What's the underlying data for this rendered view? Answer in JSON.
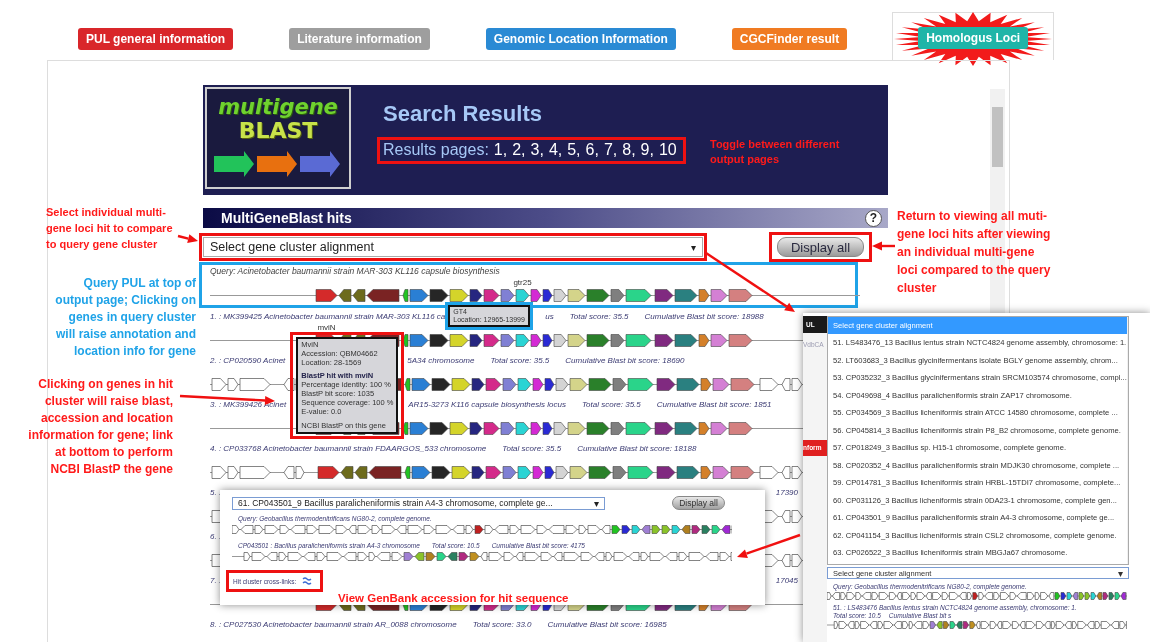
{
  "tabs": [
    {
      "label": "PUL general information",
      "color": "#d9262a",
      "selected": false
    },
    {
      "label": "Literature information",
      "color": "#9e9e9e",
      "selected": false
    },
    {
      "label": "Genomic Location Information",
      "color": "#2a8ad4",
      "selected": false
    },
    {
      "label": "CGCFinder result",
      "color": "#f07b22",
      "selected": false
    },
    {
      "label": "Homologus Loci",
      "color": "#1fb5a8",
      "selected": true
    }
  ],
  "results": {
    "logo": [
      "multigene",
      "BLAST"
    ],
    "title": "Search Results",
    "pages_label": "Results pages:",
    "pages": [
      "1,",
      "2,",
      "3,",
      "4,",
      "5,",
      "6,",
      "7,",
      "8,",
      "9,",
      "10"
    ],
    "hits_header": "MultiGeneBlast hits",
    "help": "?",
    "cluster_select": {
      "value": "Select gene cluster alignment",
      "caret": "▾"
    },
    "display_all": "Display all",
    "query": {
      "title": "Query: Acinetobacter baumannii strain MAR-303 KL116 capsule biosynthesis",
      "gene_label": "gtr25",
      "kind": "aligned"
    },
    "hits": [
      {
        "parts": [
          "1. : MK399425 Acinetobacter baumannii strain MAR-303 KL116 ca",
          "us"
        ],
        "total": "Total score: 35.5",
        "cumulative": "Cumulative Blast bit score: 18988",
        "gene_label": "mviN",
        "kind": "aligned"
      },
      {
        "parts": [
          "2. : CP020590 Acinet",
          "5A34 chromosome"
        ],
        "total": "Total score: 35.5",
        "cumulative": "Cumulative Blast bit score: 18690",
        "kind": "flanked"
      },
      {
        "parts": [
          "3. : MK399426 Acinet",
          "AR15-3273 K116 capsule biosynthesis locus"
        ],
        "total": "Total score: 35.5",
        "cumulative": "Cumulative Blast bit score: 1851",
        "kind": "aligned"
      },
      {
        "parts": [
          "4. : CP033768 Acinetobacter baumannii strain FDAARGOS_533 chromosome"
        ],
        "total": "Total score: 35.5",
        "cumulative": "Cumulative Blast bit score: 18188",
        "kind": "flanked"
      },
      {
        "parts": [
          "5. :"
        ],
        "tail": "17390",
        "kind": "flanked"
      },
      {
        "parts": [
          "6. :"
        ],
        "kind": "flanked"
      },
      {
        "parts": [
          "7. :"
        ],
        "tail": "17045",
        "kind": "aligned"
      },
      {
        "parts": [
          "8. : CP027530 Acinetobacter baumannii strain AR_0088 chromosome"
        ],
        "total": "Total score: 33.0",
        "cumulative": "Cumulative Blast bit score: 16985"
      }
    ]
  },
  "gene_tooltips": [
    {
      "lines": [
        {
          "text": "GT4",
          "kind": "plain"
        },
        {
          "text": "Location: 12965-13999",
          "kind": "plain"
        }
      ]
    },
    {
      "lines": [
        {
          "text": "MviN",
          "kind": "plain"
        },
        {
          "text": "Accession: QBM04662",
          "kind": "plain"
        },
        {
          "text": "Location: 28-1569",
          "kind": "plain"
        },
        {
          "text": "BlastP hit with mviN",
          "kind": "heading"
        },
        {
          "text": "Percentage identity: 100 %",
          "kind": "plain"
        },
        {
          "text": "BlastP bit score: 1035",
          "kind": "plain"
        },
        {
          "text": "Sequence coverage: 100 %",
          "kind": "plain"
        },
        {
          "text": "E-value: 0.0",
          "kind": "plain"
        },
        {
          "text": "NCBI BlastP on this gene",
          "kind": "link"
        }
      ]
    }
  ],
  "inset_single": {
    "select": "61. CP043501_9 Bacillus paralicheniformis strain A4-3 chromosome, complete ge...",
    "caret": "▾",
    "display_all": "Display all",
    "query": "Query: Geobacillus thermodenitrificans NG80-2, complete genome.",
    "hit": {
      "title": "CP043501 : Bacillus paralicheniformis strain A4-3 chromosome",
      "total": "Total score: 10.5",
      "cumulative": "Cumulative Blast bit score: 4175"
    },
    "crosslinks_label": "Hit cluster cross-links:"
  },
  "inset_list": {
    "behind": [
      "UL",
      "VdbCA",
      "nform"
    ],
    "items": [
      {
        "text": "Select gene cluster alignment",
        "selected": true
      },
      {
        "text": "51. LS483476_13 Bacillus lentus strain NCTC4824 genome assembly, chromosome: 1.",
        "selected": false
      },
      {
        "text": "52. LT603683_3 Bacillus glycinifermentans isolate BGLY genome assembly, chrom...",
        "selected": false
      },
      {
        "text": "53. CP035232_3 Bacillus glycinifermentans strain SRCM103574 chromosome, compl...",
        "selected": false
      },
      {
        "text": "54. CP049698_4 Bacillus paralicheniformis strain ZAP17 chromosome.",
        "selected": false
      },
      {
        "text": "55. CP034569_3 Bacillus licheniformis strain ATCC 14580 chromosome, complete ...",
        "selected": false
      },
      {
        "text": "56. CP045814_3 Bacillus licheniformis strain P8_B2 chromosome, complete genome.",
        "selected": false
      },
      {
        "text": "57. CP018249_3 Bacillus sp. H15-1 chromosome, complete genome.",
        "selected": false
      },
      {
        "text": "58. CP020352_4 Bacillus paralicheniformis strain MDJK30 chromosome, complete ...",
        "selected": false
      },
      {
        "text": "59. CP014781_3 Bacillus licheniformis strain HRBL-15TDI7 chromosome, complete...",
        "selected": false
      },
      {
        "text": "60. CP031126_3 Bacillus licheniformis strain 0DA23-1 chromosome, complete gen...",
        "selected": false
      },
      {
        "text": "61. CP043501_9 Bacillus paralicheniformis strain A4-3 chromosome, complete ge...",
        "selected": false
      },
      {
        "text": "62. CP041154_3 Bacillus licheniformis strain CSL2 chromosome, complete genome.",
        "selected": false
      },
      {
        "text": "63. CP026522_3 Bacillus licheniformis strain MBGJa67 chromosome.",
        "selected": false
      }
    ],
    "select": "Select gene cluster alignment",
    "caret": "▾",
    "query": "Query: Geobacillus thermodenitrificans NG80-2, complete genome.",
    "hit": {
      "title": "51. : LS483476 Bacillus lentus strain NCTC4824 genome assembly, chromosome: 1.",
      "total": "Total score: 10.5",
      "cumulative": "Cumulative Blast bit s"
    }
  },
  "notes": [
    {
      "kind": "pages",
      "text": "Toggle between different output pages",
      "color": "#ff1a1a"
    },
    {
      "kind": "select",
      "text": "Select individual multi-gene loci hit to compare to query gene cluster",
      "color": "#ff1a1a"
    },
    {
      "kind": "query",
      "text": "Query PUL at top of output page; Clicking on genes in query cluster will raise annotation and location info for gene",
      "color": "#1fa3e8"
    },
    {
      "kind": "hitgene",
      "text": "Clicking on genes in hit cluster will raise blast, accession and location information for gene; link at bottom to perform NCBI BlastP the gene",
      "color": "#ff1a1a"
    },
    {
      "kind": "display",
      "text": "Return to viewing all muti-gene loci hits after viewing an individual multi-gene loci compared to the query cluster",
      "color": "#ff1a1a"
    },
    {
      "kind": "crosslinks",
      "text": "View GenBank accession for hit sequence",
      "color": "#ff1a1a"
    }
  ]
}
